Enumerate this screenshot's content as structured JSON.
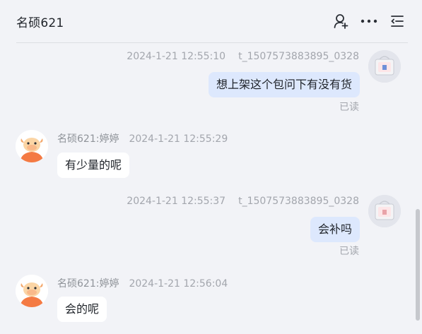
{
  "header": {
    "title": "名硕621"
  },
  "icons": {
    "add_user": "user-plus-icon",
    "more": "more-dots-icon",
    "menu": "list-menu-icon"
  },
  "messages": [
    {
      "direction": "out",
      "time": "2024-1-21 12:55:10",
      "sender": "t_1507573883895_0328",
      "text": "想上架这个包问下有没有货",
      "status": "已读"
    },
    {
      "direction": "in",
      "sender": "名硕621:婷婷",
      "time": "2024-1-21 12:55:29",
      "text": "有少量的呢"
    },
    {
      "direction": "out",
      "time": "2024-1-21 12:55:37",
      "sender": "t_1507573883895_0328",
      "text": "会补吗",
      "status": "已读"
    },
    {
      "direction": "in",
      "sender": "名硕621:婷婷",
      "time": "2024-1-21 12:56:04",
      "text": "会的呢"
    }
  ],
  "colors": {
    "background": "#f2f3f7",
    "outgoing_bubble": "#dde8fd",
    "incoming_bubble": "#ffffff",
    "meta_text": "#a3a6ad",
    "staff_avatar_accent": "#f47a43"
  }
}
